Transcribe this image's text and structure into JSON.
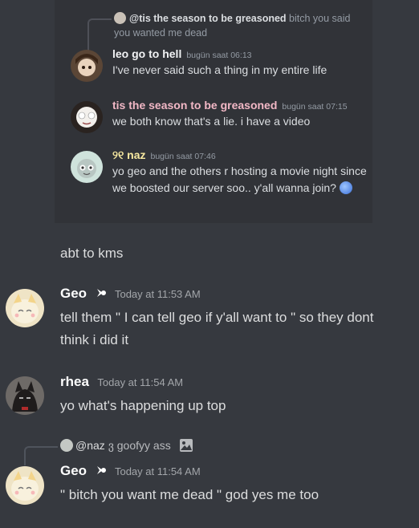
{
  "embed": {
    "reply": {
      "mention": "@tis the season to be greasoned",
      "text": " bitch you said you wanted me dead"
    },
    "messages": [
      {
        "name": "leo go to hell",
        "name_color": "#f2f3f5",
        "time": "bugün saat 06:13",
        "text": "I've never said such a thing in my entire life"
      },
      {
        "name": "tis the season to be greasoned",
        "name_color": "#f2b8c6",
        "time": "bugün saat 07:15",
        "text": "we both know that's a lie. i have a video"
      },
      {
        "name": "୨୧ naz",
        "name_color": "#f7e9a0",
        "time": "bugün saat 07:46",
        "text": "yo geo and the others r hosting a movie night since we boosted our server soo.. y'all wanna join?"
      }
    ]
  },
  "chat": {
    "continuation": "abt to kms",
    "messages": [
      {
        "name": "Geo",
        "time": "Today at 11:53 AM",
        "text": "tell them \" I can tell geo if y'all want to \" so they dont think i did it"
      },
      {
        "name": "rhea",
        "time": "Today at 11:54 AM",
        "text": "yo what's happening up top"
      },
      {
        "name": "Geo",
        "time": "Today at 11:54 AM",
        "text": "\" bitch you want me dead \" god yes me too"
      }
    ],
    "reply": {
      "mention": "@naz",
      "glyph": "ვ",
      "text": " goofyy ass"
    }
  },
  "colors": {
    "background": "#36393f",
    "embed_background": "#313338"
  }
}
